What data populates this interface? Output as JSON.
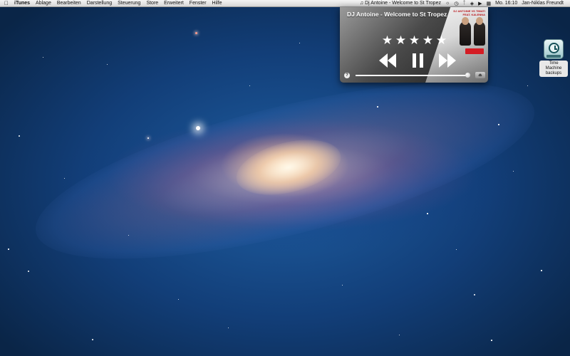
{
  "menubar": {
    "apple_icon": "apple-logo-icon",
    "app_name": "iTunes",
    "menus": [
      "Ablage",
      "Bearbeiten",
      "Darstellung",
      "Steuerung",
      "Store",
      "Erweitert",
      "Fenster",
      "Hilfe"
    ],
    "now_playing_label": "♫ Dj Antoine - Welcome to St Tropez",
    "status_icons": [
      "brightness-icon",
      "time-machine-icon",
      "bluetooth-icon",
      "wifi-icon",
      "volume-icon",
      "input-menu-icon"
    ],
    "clock": "Mo. 16:10",
    "user": "Jan-Niklas Freundt"
  },
  "player": {
    "track_title": "DJ Antoine - Welcome to St Tropez",
    "rating_stars": 5,
    "cover_text": "DJ ANTOINE VS TIMATI FEAT. KALENNA",
    "progress_fraction": 0.98,
    "help_label": "?",
    "controls": {
      "previous_icon": "rewind-icon",
      "play_pause_icon": "pause-icon",
      "next_icon": "fast-forward-icon",
      "eject_icon": "eject-icon"
    }
  },
  "desktop": {
    "icons": [
      {
        "label": "Time Machine backups",
        "icon": "time-machine-icon"
      }
    ]
  },
  "colors": {
    "menubar_bg": "#e6e6e6",
    "player_bg": "#262626",
    "wallpaper_deep": "#0a2547",
    "wallpaper_mid": "#1f5fa3"
  }
}
